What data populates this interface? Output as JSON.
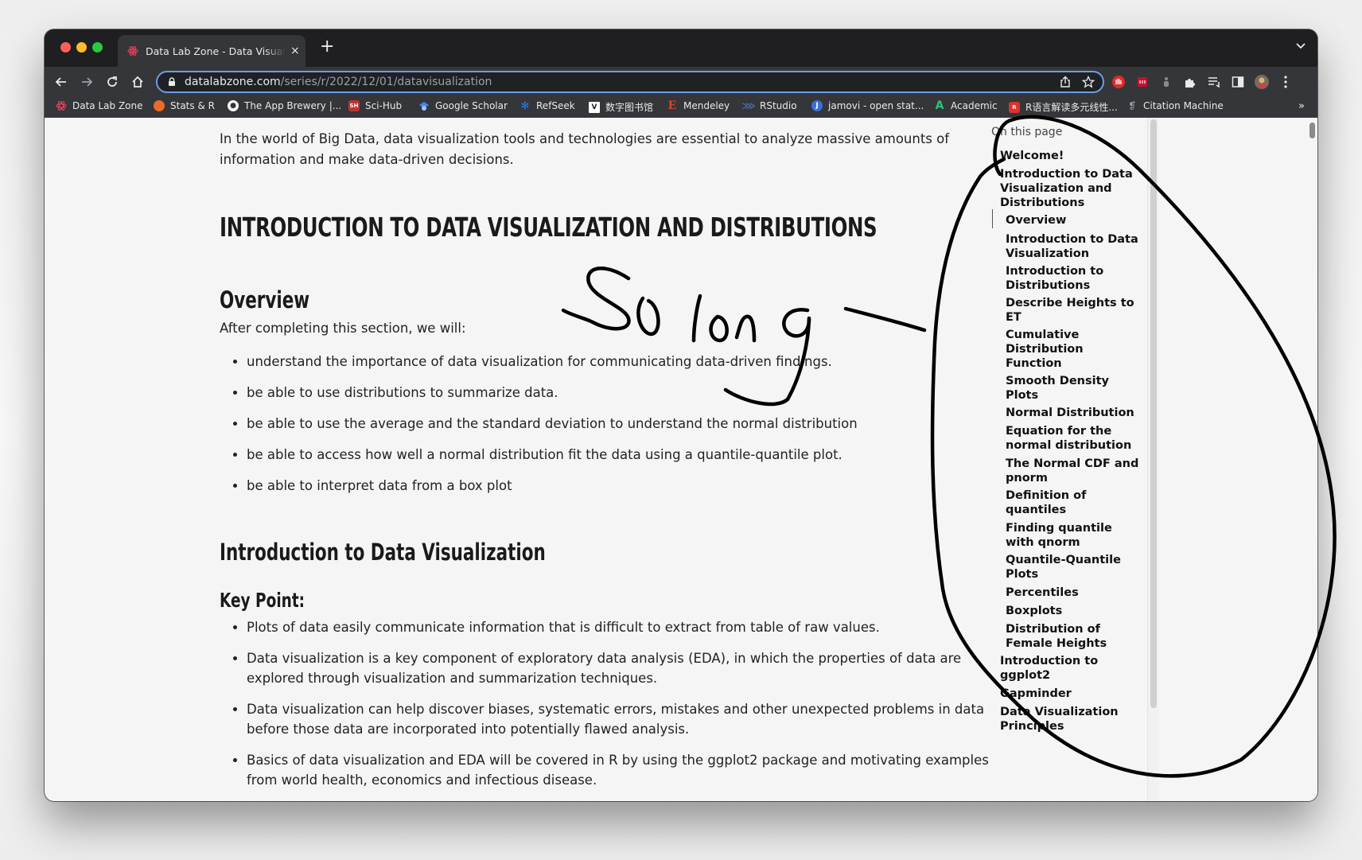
{
  "browser": {
    "tab_title": "Data Lab Zone - Data Visualization",
    "url_host": "datalabzone.com",
    "url_path": "/series/r/2022/12/01/datavisualization",
    "tab_close_glyph": "×",
    "new_tab_glyph": "+"
  },
  "bookmarks": [
    {
      "label": "Data Lab Zone",
      "icon": "atom-icon",
      "color": "#e0425a"
    },
    {
      "label": "Stats & R",
      "icon": "chart-icon",
      "color": "#e86b2b"
    },
    {
      "label": "The App Brewery |...",
      "icon": "app-brewery-icon",
      "color": "#f5f5f5"
    },
    {
      "label": "Sci-Hub",
      "icon": "scihub-icon",
      "color": "#b33"
    },
    {
      "label": "Google Scholar",
      "icon": "scholar-icon",
      "color": "#4285f4"
    },
    {
      "label": "RefSeek",
      "icon": "refseek-icon",
      "color": "#2a7ae2"
    },
    {
      "label": "数字图书馆",
      "icon": "v-icon",
      "color": "#ffffff"
    },
    {
      "label": "Mendeley",
      "icon": "mendeley-icon",
      "color": "#d9442b"
    },
    {
      "label": "RStudio",
      "icon": "rstudio-icon",
      "color": "#4a6fa5"
    },
    {
      "label": "jamovi - open stat...",
      "icon": "jamovi-icon",
      "color": "#3b6fd4"
    },
    {
      "label": "Academic",
      "icon": "academic-icon",
      "color": "#2ec27e"
    },
    {
      "label": "R语言解读多元线性...",
      "icon": "r-icon",
      "color": "#e0322c"
    },
    {
      "label": "Citation Machine",
      "icon": "citation-icon",
      "color": "#9aa0a6"
    }
  ],
  "bookmarks_more": "»",
  "page": {
    "intro": "In the world of Big Data, data visualization tools and technologies are essential to analyze massive amounts of information and make data-driven decisions.",
    "h1": "INTRODUCTION TO DATA VISUALIZATION AND DISTRIBUTIONS",
    "overview_heading": "Overview",
    "overview_lead": "After completing this section, we will:",
    "overview_bullets": [
      "understand the importance of data visualization for communicating data-driven findings.",
      "be able to use distributions to summarize data.",
      "be able to use the average and the standard deviation to understand the normal distribution",
      "be able to access how well a normal distribution fit the data using a quantile-quantile plot.",
      "be able to interpret data from a box plot"
    ],
    "intro_dv_heading": "Introduction to Data Visualization",
    "keypoint_heading": "Key Point:",
    "keypoint_bullets": [
      "Plots of data easily communicate information that is difficult to extract from table of raw values.",
      "Data visualization is a key component of exploratory data analysis (EDA), in which the properties of data are explored through visualization and summarization techniques.",
      "Data visualization can help discover biases, systematic errors, mistakes and other unexpected problems in data before those data are incorporated into potentially flawed analysis.",
      "Basics of data visualization and EDA will be covered in R by using the ggplot2 package and motivating examples from world health, economics and infectious disease."
    ]
  },
  "toc": {
    "heading": "On this page",
    "items": [
      {
        "label": "Welcome!",
        "level": 1
      },
      {
        "label": "Introduction to Data Visualization and Distributions",
        "level": 1
      },
      {
        "label": "Overview",
        "level": 2,
        "active": true
      },
      {
        "label": "Introduction to Data Visualization",
        "level": 2
      },
      {
        "label": "Introduction to Distributions",
        "level": 2
      },
      {
        "label": "Describe Heights to ET",
        "level": 2
      },
      {
        "label": "Cumulative Distribution Function",
        "level": 2
      },
      {
        "label": "Smooth Density Plots",
        "level": 2
      },
      {
        "label": "Normal Distribution",
        "level": 2
      },
      {
        "label": "Equation for the normal distribution",
        "level": 2
      },
      {
        "label": "The Normal CDF and pnorm",
        "level": 2
      },
      {
        "label": "Definition of quantiles",
        "level": 2
      },
      {
        "label": "Finding quantile with qnorm",
        "level": 2
      },
      {
        "label": "Quantile-Quantile Plots",
        "level": 2
      },
      {
        "label": "Percentiles",
        "level": 2
      },
      {
        "label": "Boxplots",
        "level": 2
      },
      {
        "label": "Distribution of Female Heights",
        "level": 2
      },
      {
        "label": "Introduction to ggplot2",
        "level": 1
      },
      {
        "label": "Gapminder",
        "level": 1
      },
      {
        "label": "Data Visualization Principles",
        "level": 1
      }
    ]
  },
  "annotation": {
    "handwritten_text": "So long"
  }
}
